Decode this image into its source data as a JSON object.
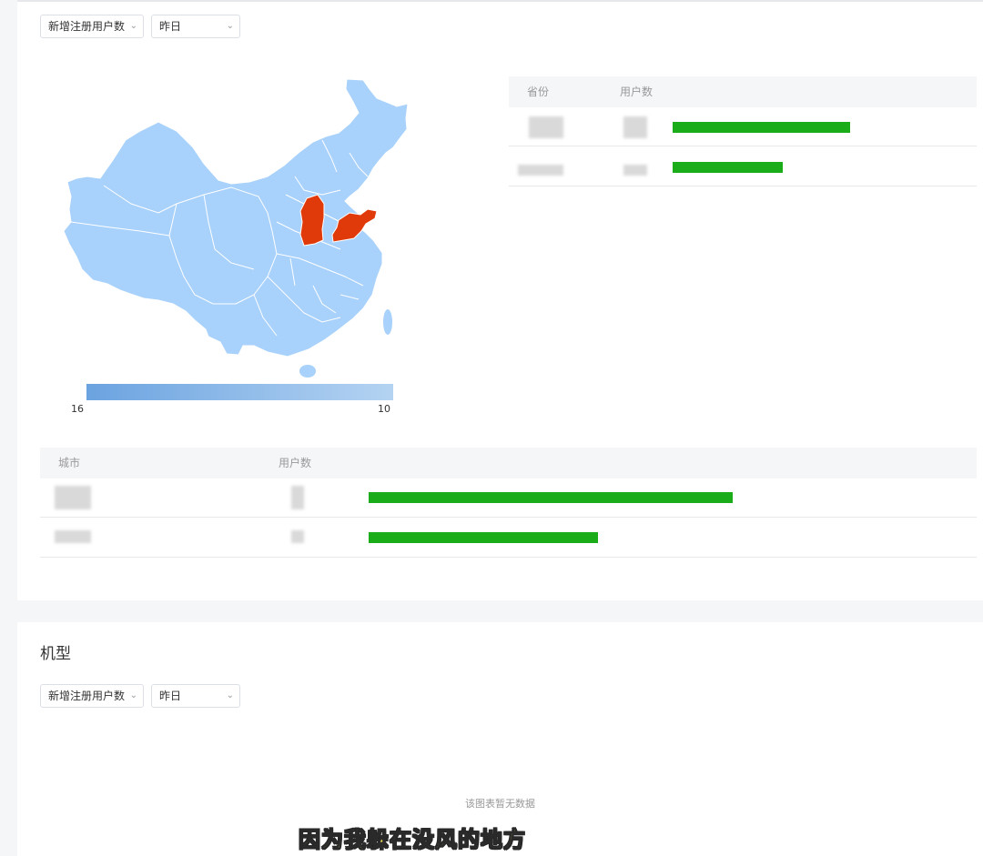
{
  "region": {
    "metric_select": "新增注册用户数",
    "date_select": "昨日",
    "legend": {
      "min_label": "16",
      "max_label": "10"
    },
    "province_table": {
      "headers": [
        "省份",
        "用户数"
      ],
      "rows": [
        {
          "bar_fraction": 1.0
        },
        {
          "bar_fraction": 0.62
        }
      ]
    },
    "city_table": {
      "headers": [
        "城市",
        "用户数"
      ],
      "rows": [
        {
          "bar_fraction": 1.0
        },
        {
          "bar_fraction": 0.63
        }
      ]
    },
    "map_colors": {
      "base": "#a8d1fb",
      "highlight": "#e03a0b"
    }
  },
  "model": {
    "title": "机型",
    "metric_select": "新增注册用户数",
    "date_select": "昨日",
    "empty_text": "该图表暂无数据"
  },
  "subtitle": "因为我躲在没风的地方",
  "colors": {
    "bar": "#1aad19",
    "accent": "#e03a0b"
  }
}
